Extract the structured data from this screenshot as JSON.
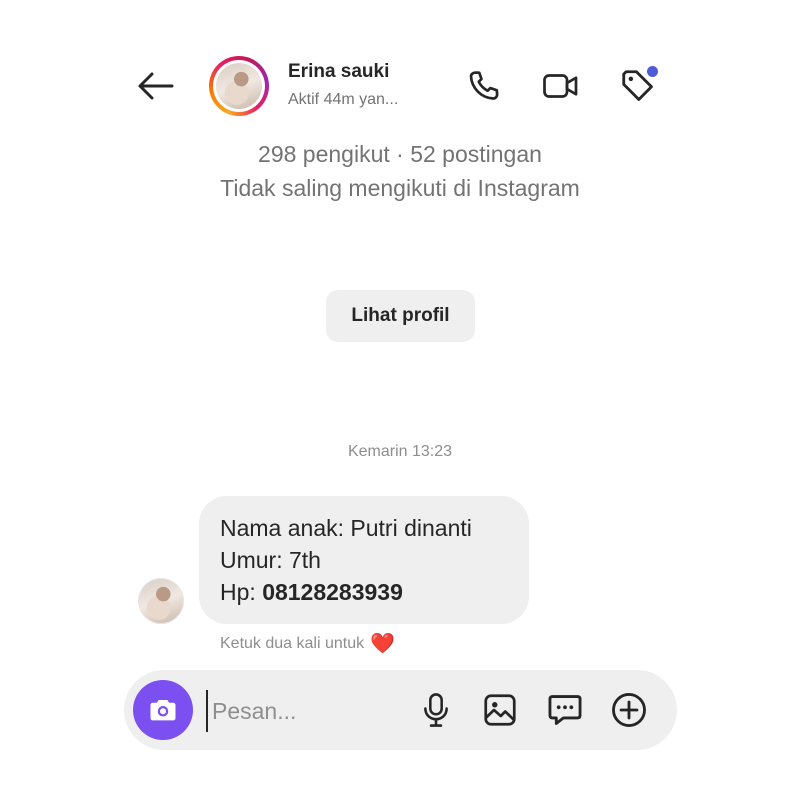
{
  "header": {
    "name": "Erina sauki",
    "status": "Aktif 44m yan...",
    "icons": [
      "back-arrow-icon",
      "phone-call-icon",
      "video-call-icon",
      "tag-icon"
    ],
    "tag_dot_color": "#4f5bd5"
  },
  "profile": {
    "stats": "298 pengikut · 52 postingan",
    "follow_status": "Tidak saling mengikuti di Instagram",
    "view_profile_label": "Lihat profil"
  },
  "conversation": {
    "timestamp": "Kemarin 13:23",
    "message": {
      "line1": "Nama anak: Putri dinanti",
      "line2": "Umur: 7th",
      "line3_prefix": "Hp: ",
      "line3_phone": "08128283939"
    },
    "react_hint": "Ketuk dua kali untuk",
    "react_emoji": "❤️"
  },
  "composer": {
    "placeholder": "Pesan...",
    "camera_color": "#7b4ff0",
    "icons": [
      "camera-icon",
      "microphone-icon",
      "gallery-icon",
      "sticker-message-icon",
      "plus-icon"
    ]
  }
}
